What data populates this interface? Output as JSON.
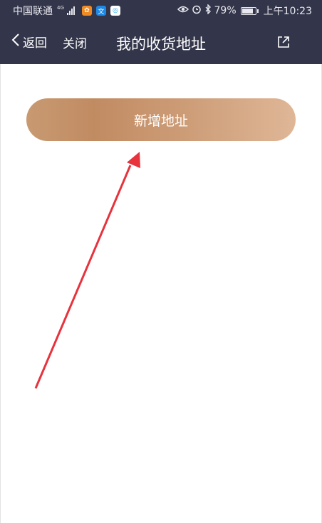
{
  "status_bar": {
    "carrier": "中国联通",
    "network": "4G",
    "battery": "79%",
    "time": "上午10:23",
    "icons": [
      "signal-icon",
      "app-icon",
      "translate-app-icon",
      "browser-app-icon",
      "eye-icon",
      "alarm-icon",
      "bluetooth-icon",
      "battery-icon"
    ]
  },
  "nav": {
    "back_label": "返回",
    "close_label": "关闭",
    "title": "我的收货地址",
    "share_icon": "share-icon"
  },
  "main": {
    "add_button_label": "新增地址"
  },
  "colors": {
    "header_bg": "#33354a",
    "button_gradient_start": "#c18b62",
    "button_gradient_end": "#dfb797",
    "annotation_arrow": "#e8323c"
  }
}
